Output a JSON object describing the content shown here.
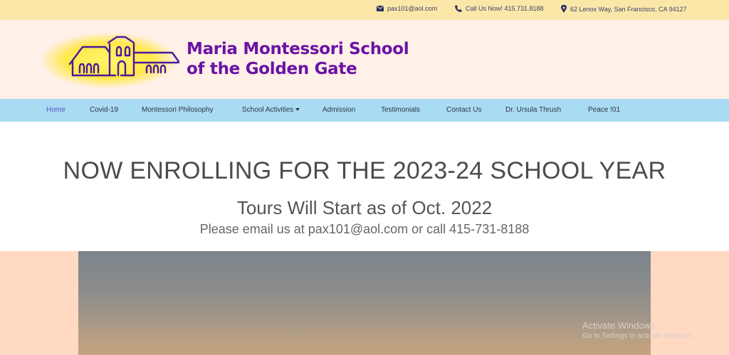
{
  "topbar": {
    "email": "pax101@aol.com",
    "phone": "Call Us Now! 415.731.8188",
    "address": "62 Lenox Way, San Francisco, CA 94127",
    "icons": [
      "envelope-icon",
      "phone-icon",
      "map-marker-icon"
    ]
  },
  "header": {
    "logo_line1": "Maria Montessori School",
    "logo_line2": "of the Golden Gate",
    "brand_color": "#6a12a6"
  },
  "nav": {
    "items": [
      {
        "label": "Home",
        "active": true
      },
      {
        "label": "Covid-19"
      },
      {
        "label": "Montessori Philosophy"
      },
      {
        "label": "School Activities",
        "dropdown": true
      },
      {
        "label": "Admission"
      },
      {
        "label": "Testimonials"
      },
      {
        "label": "Contact Us"
      },
      {
        "label": "Dr. Ursula Thrush"
      },
      {
        "label": "Peace !01"
      }
    ]
  },
  "hero": {
    "headline": "NOW ENROLLING FOR THE 2023-24 SCHOOL YEAR",
    "subheadline": "Tours Will Start as of Oct. 2022",
    "contact_line": "Please email us at pax101@aol.com or call 415-731-8188"
  },
  "watermark": {
    "line1": "Activate Windows",
    "line2": "Go to Settings to activate Windows."
  },
  "colors": {
    "topbar_bg": "#fbe8a8",
    "header_bg": "#fff0e8",
    "nav_bg": "#a9dcf2",
    "lower_bg": "#ffd9c2"
  }
}
